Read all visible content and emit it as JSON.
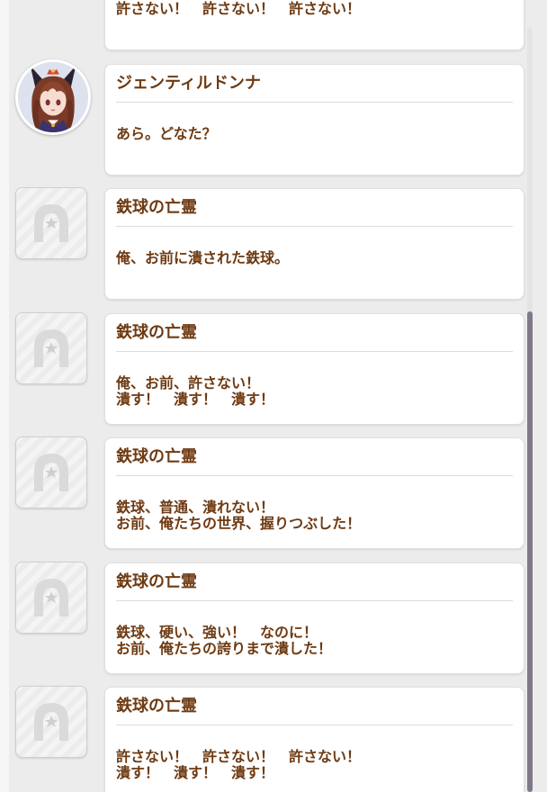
{
  "log": {
    "entries": [
      {
        "speaker": "",
        "avatar": "none",
        "message": "許さない！　許さない！　許さない！"
      },
      {
        "speaker": "ジェンティルドンナ",
        "avatar": "character-portrait",
        "message": "あら。どなた？"
      },
      {
        "speaker": "鉄球の亡霊",
        "avatar": "horseshoe-icon",
        "message": "俺、お前に潰された鉄球。"
      },
      {
        "speaker": "鉄球の亡霊",
        "avatar": "horseshoe-icon",
        "message": "俺、お前、許さない！\n潰す！　潰す！　潰す！"
      },
      {
        "speaker": "鉄球の亡霊",
        "avatar": "horseshoe-icon",
        "message": "鉄球、普通、潰れない！\nお前、俺たちの世界、握りつぶした！"
      },
      {
        "speaker": "鉄球の亡霊",
        "avatar": "horseshoe-icon",
        "message": "鉄球、硬い、強い！　なのに！\nお前、俺たちの誇りまで潰した！"
      },
      {
        "speaker": "鉄球の亡霊",
        "avatar": "horseshoe-icon",
        "message": "許さない！　許さない！　許さない！\n潰す！　潰す！　潰す！"
      }
    ]
  },
  "colors": {
    "text_brown": "#6e3a12",
    "bubble_bg": "#ffffff",
    "page_bg": "#ececec",
    "scroll_thumb": "#807a86"
  }
}
